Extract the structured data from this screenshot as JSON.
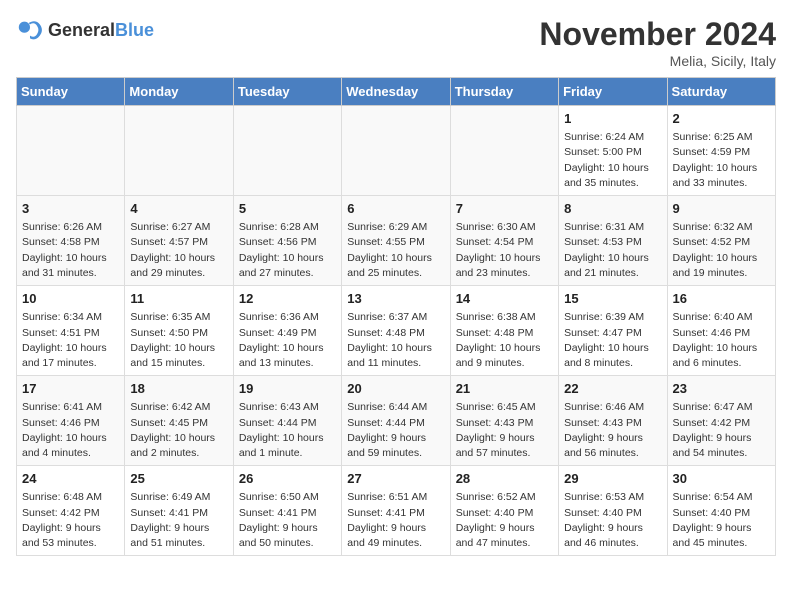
{
  "logo": {
    "general": "General",
    "blue": "Blue"
  },
  "title": "November 2024",
  "location": "Melia, Sicily, Italy",
  "weekdays": [
    "Sunday",
    "Monday",
    "Tuesday",
    "Wednesday",
    "Thursday",
    "Friday",
    "Saturday"
  ],
  "weeks": [
    [
      {
        "day": "",
        "info": ""
      },
      {
        "day": "",
        "info": ""
      },
      {
        "day": "",
        "info": ""
      },
      {
        "day": "",
        "info": ""
      },
      {
        "day": "",
        "info": ""
      },
      {
        "day": "1",
        "info": "Sunrise: 6:24 AM\nSunset: 5:00 PM\nDaylight: 10 hours\nand 35 minutes."
      },
      {
        "day": "2",
        "info": "Sunrise: 6:25 AM\nSunset: 4:59 PM\nDaylight: 10 hours\nand 33 minutes."
      }
    ],
    [
      {
        "day": "3",
        "info": "Sunrise: 6:26 AM\nSunset: 4:58 PM\nDaylight: 10 hours\nand 31 minutes."
      },
      {
        "day": "4",
        "info": "Sunrise: 6:27 AM\nSunset: 4:57 PM\nDaylight: 10 hours\nand 29 minutes."
      },
      {
        "day": "5",
        "info": "Sunrise: 6:28 AM\nSunset: 4:56 PM\nDaylight: 10 hours\nand 27 minutes."
      },
      {
        "day": "6",
        "info": "Sunrise: 6:29 AM\nSunset: 4:55 PM\nDaylight: 10 hours\nand 25 minutes."
      },
      {
        "day": "7",
        "info": "Sunrise: 6:30 AM\nSunset: 4:54 PM\nDaylight: 10 hours\nand 23 minutes."
      },
      {
        "day": "8",
        "info": "Sunrise: 6:31 AM\nSunset: 4:53 PM\nDaylight: 10 hours\nand 21 minutes."
      },
      {
        "day": "9",
        "info": "Sunrise: 6:32 AM\nSunset: 4:52 PM\nDaylight: 10 hours\nand 19 minutes."
      }
    ],
    [
      {
        "day": "10",
        "info": "Sunrise: 6:34 AM\nSunset: 4:51 PM\nDaylight: 10 hours\nand 17 minutes."
      },
      {
        "day": "11",
        "info": "Sunrise: 6:35 AM\nSunset: 4:50 PM\nDaylight: 10 hours\nand 15 minutes."
      },
      {
        "day": "12",
        "info": "Sunrise: 6:36 AM\nSunset: 4:49 PM\nDaylight: 10 hours\nand 13 minutes."
      },
      {
        "day": "13",
        "info": "Sunrise: 6:37 AM\nSunset: 4:48 PM\nDaylight: 10 hours\nand 11 minutes."
      },
      {
        "day": "14",
        "info": "Sunrise: 6:38 AM\nSunset: 4:48 PM\nDaylight: 10 hours\nand 9 minutes."
      },
      {
        "day": "15",
        "info": "Sunrise: 6:39 AM\nSunset: 4:47 PM\nDaylight: 10 hours\nand 8 minutes."
      },
      {
        "day": "16",
        "info": "Sunrise: 6:40 AM\nSunset: 4:46 PM\nDaylight: 10 hours\nand 6 minutes."
      }
    ],
    [
      {
        "day": "17",
        "info": "Sunrise: 6:41 AM\nSunset: 4:46 PM\nDaylight: 10 hours\nand 4 minutes."
      },
      {
        "day": "18",
        "info": "Sunrise: 6:42 AM\nSunset: 4:45 PM\nDaylight: 10 hours\nand 2 minutes."
      },
      {
        "day": "19",
        "info": "Sunrise: 6:43 AM\nSunset: 4:44 PM\nDaylight: 10 hours\nand 1 minute."
      },
      {
        "day": "20",
        "info": "Sunrise: 6:44 AM\nSunset: 4:44 PM\nDaylight: 9 hours\nand 59 minutes."
      },
      {
        "day": "21",
        "info": "Sunrise: 6:45 AM\nSunset: 4:43 PM\nDaylight: 9 hours\nand 57 minutes."
      },
      {
        "day": "22",
        "info": "Sunrise: 6:46 AM\nSunset: 4:43 PM\nDaylight: 9 hours\nand 56 minutes."
      },
      {
        "day": "23",
        "info": "Sunrise: 6:47 AM\nSunset: 4:42 PM\nDaylight: 9 hours\nand 54 minutes."
      }
    ],
    [
      {
        "day": "24",
        "info": "Sunrise: 6:48 AM\nSunset: 4:42 PM\nDaylight: 9 hours\nand 53 minutes."
      },
      {
        "day": "25",
        "info": "Sunrise: 6:49 AM\nSunset: 4:41 PM\nDaylight: 9 hours\nand 51 minutes."
      },
      {
        "day": "26",
        "info": "Sunrise: 6:50 AM\nSunset: 4:41 PM\nDaylight: 9 hours\nand 50 minutes."
      },
      {
        "day": "27",
        "info": "Sunrise: 6:51 AM\nSunset: 4:41 PM\nDaylight: 9 hours\nand 49 minutes."
      },
      {
        "day": "28",
        "info": "Sunrise: 6:52 AM\nSunset: 4:40 PM\nDaylight: 9 hours\nand 47 minutes."
      },
      {
        "day": "29",
        "info": "Sunrise: 6:53 AM\nSunset: 4:40 PM\nDaylight: 9 hours\nand 46 minutes."
      },
      {
        "day": "30",
        "info": "Sunrise: 6:54 AM\nSunset: 4:40 PM\nDaylight: 9 hours\nand 45 minutes."
      }
    ]
  ]
}
